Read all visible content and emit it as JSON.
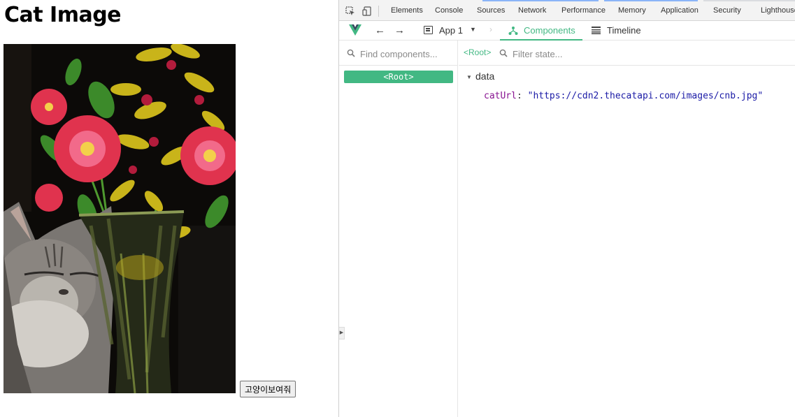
{
  "page": {
    "title": "Cat Image",
    "button_label": "고양이보여줘"
  },
  "devtools": {
    "tabs": [
      "Elements",
      "Console",
      "Sources",
      "Network",
      "Performance",
      "Memory",
      "Application",
      "Security",
      "Lighthouse"
    ],
    "vue": {
      "app_label": "App 1",
      "breadcrumb_sep": "›",
      "components_label": "Components",
      "timeline_label": "Timeline",
      "find_placeholder": "Find components...",
      "root_label": "<Root>",
      "state_breadcrumb": "<Root>",
      "filter_placeholder": "Filter state...",
      "data_section": "data",
      "state": {
        "key": "catUrl",
        "value": "\"https://cdn2.thecatapi.com/images/cnb.jpg\""
      }
    }
  },
  "colors": {
    "vue_green": "#42b883",
    "state_key": "#881391",
    "state_value": "#1a1aa6"
  },
  "icons": [
    "inspect-icon",
    "device-toggle-icon",
    "vue-logo-icon",
    "back-arrow-icon",
    "forward-arrow-icon",
    "app-window-icon",
    "chevron-down-icon",
    "components-tree-icon",
    "timeline-icon",
    "search-icon",
    "caret-down-icon",
    "chevron-right-icon"
  ]
}
